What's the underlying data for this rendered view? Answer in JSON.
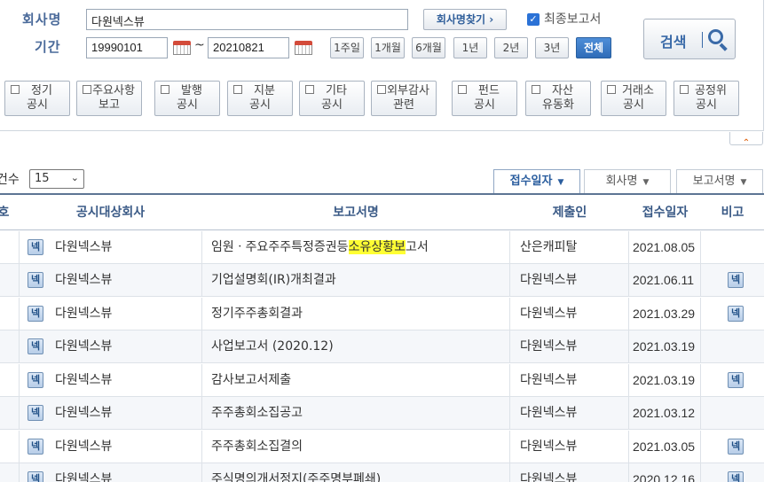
{
  "search": {
    "company_label": "회사명",
    "company_value": "다원넥스뷰",
    "find_company_label": "회사명찾기 ›",
    "final_report_label": "최종보고서",
    "final_report_checked": true,
    "period_label": "기간",
    "date_from": "19990101",
    "date_to": "20210821",
    "period_sep": "~",
    "period_buttons": [
      "1주일",
      "1개월",
      "6개월",
      "1년",
      "2년",
      "3년",
      "전체"
    ],
    "period_active": "전체",
    "search_label": "검색"
  },
  "report_kinds": [
    [
      "정기",
      "공시"
    ],
    [
      "주요사항",
      "보고"
    ],
    [
      "발행",
      "공시"
    ],
    [
      "지분",
      "공시"
    ],
    [
      "기타",
      "공시"
    ],
    [
      "외부감사",
      "관련"
    ],
    [
      "펀드",
      "공시"
    ],
    [
      "자산",
      "유동화"
    ],
    [
      "거래소",
      "공시"
    ],
    [
      "공정위",
      "공시"
    ]
  ],
  "collapse_icon": "chevron-up-icon",
  "list_controls": {
    "count_label": "건수",
    "count_value": "15",
    "sort_buttons": [
      {
        "label": "접수일자",
        "active": true
      },
      {
        "label": "회사명",
        "active": false
      },
      {
        "label": "보고서명",
        "active": false
      }
    ]
  },
  "table": {
    "headers": [
      "호",
      "공시대상회사",
      "보고서명",
      "제출인",
      "접수일자",
      "비고"
    ],
    "rows": [
      {
        "company": "다원넥스뷰",
        "report_pre": "임원ㆍ주요주주특정증권등",
        "report_hl": "소유상황보",
        "report_post": "고서",
        "submitter": "산은캐피탈",
        "date": "2021.08.05",
        "note": ""
      },
      {
        "company": "다원넥스뷰",
        "report_pre": "기업설명회(IR)개최결과",
        "report_hl": "",
        "report_post": "",
        "submitter": "다원넥스뷰",
        "date": "2021.06.11",
        "note": "넥"
      },
      {
        "company": "다원넥스뷰",
        "report_pre": "정기주주총회결과",
        "report_hl": "",
        "report_post": "",
        "submitter": "다원넥스뷰",
        "date": "2021.03.29",
        "note": "넥"
      },
      {
        "company": "다원넥스뷰",
        "report_pre": "사업보고서 (2020.12)",
        "report_hl": "",
        "report_post": "",
        "submitter": "다원넥스뷰",
        "date": "2021.03.19",
        "note": ""
      },
      {
        "company": "다원넥스뷰",
        "report_pre": "감사보고서제출",
        "report_hl": "",
        "report_post": "",
        "submitter": "다원넥스뷰",
        "date": "2021.03.19",
        "note": "넥"
      },
      {
        "company": "다원넥스뷰",
        "report_pre": "주주총회소집공고",
        "report_hl": "",
        "report_post": "",
        "submitter": "다원넥스뷰",
        "date": "2021.03.12",
        "note": ""
      },
      {
        "company": "다원넥스뷰",
        "report_pre": "주주총회소집결의",
        "report_hl": "",
        "report_post": "",
        "submitter": "다원넥스뷰",
        "date": "2021.03.05",
        "note": "넥"
      },
      {
        "company": "다원넥스뷰",
        "report_pre": "주식명의개서정지(주주명부폐쇄)",
        "report_hl": "",
        "report_post": "",
        "submitter": "다원넥스뷰",
        "date": "2020.12.16",
        "note": "넥"
      }
    ],
    "company_badge": "넥"
  },
  "colors": {
    "label_blue": "#4a6a9a",
    "header_blue": "#3a5a86",
    "active_button": "#2f6cb8",
    "highlight": "#ffff33"
  }
}
